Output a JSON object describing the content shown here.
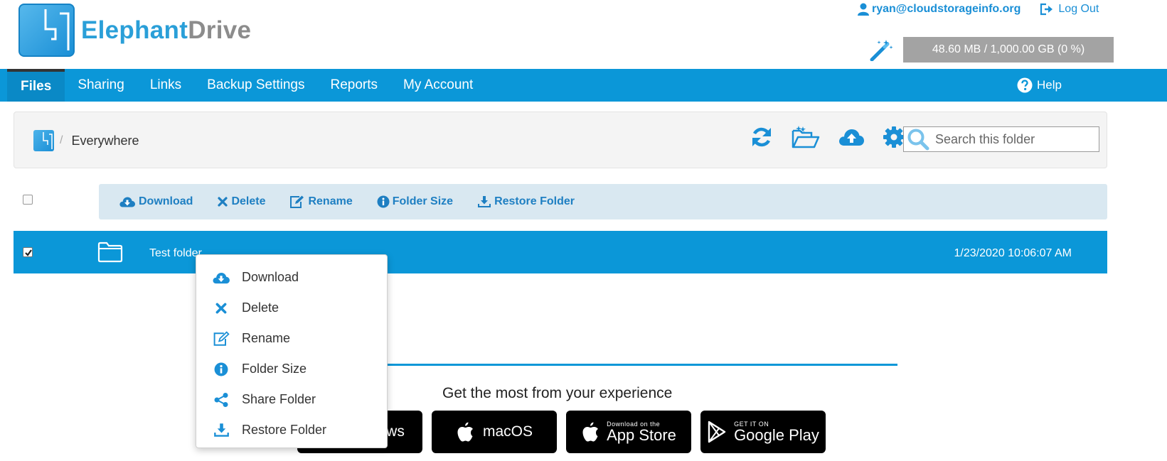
{
  "header": {
    "logo_word1": "Elephant",
    "logo_word2": "Drive",
    "user_email": "ryan@cloudstorageinfo.org",
    "logout_label": "Log Out",
    "storage_usage": "48.60 MB / 1,000.00 GB (0 %)"
  },
  "nav": {
    "items": [
      {
        "label": "Files",
        "active": true
      },
      {
        "label": "Sharing"
      },
      {
        "label": "Links"
      },
      {
        "label": "Backup Settings"
      },
      {
        "label": "Reports"
      },
      {
        "label": "My Account"
      }
    ],
    "help_label": "Help"
  },
  "breadcrumb": {
    "separator": "/",
    "current": "Everywhere"
  },
  "toolbar": {
    "icons": [
      "refresh-icon",
      "new-folder-icon",
      "upload-cloud-icon",
      "gear-icon"
    ],
    "search_placeholder": "Search this folder"
  },
  "actions": {
    "download": "Download",
    "delete": "Delete",
    "rename": "Rename",
    "folder_size": "Folder Size",
    "restore_folder": "Restore Folder"
  },
  "file_row": {
    "name": "Test folder",
    "modified": "1/23/2020 10:06:07 AM",
    "selected": true
  },
  "context_menu": {
    "items": [
      {
        "label": "Download",
        "icon": "cloud-download-icon"
      },
      {
        "label": "Delete",
        "icon": "close-icon"
      },
      {
        "label": "Rename",
        "icon": "edit-icon"
      },
      {
        "label": "Folder Size",
        "icon": "info-icon"
      },
      {
        "label": "Share Folder",
        "icon": "share-icon"
      },
      {
        "label": "Restore Folder",
        "icon": "restore-download-icon"
      }
    ]
  },
  "promo": {
    "title": "Get the most from your experience",
    "windows_label": "ws",
    "macos_label": "macOS",
    "appstore_small": "Download on the",
    "appstore_large": "App Store",
    "googleplay_small": "GET IT ON",
    "googleplay_large": "Google Play"
  },
  "colors": {
    "brand_blue": "#0b97d8",
    "action_bar_bg": "#d9e8f1",
    "storage_bar": "#a3a3a3"
  }
}
